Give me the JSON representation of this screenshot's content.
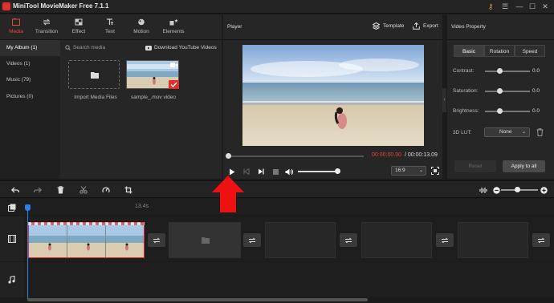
{
  "window": {
    "title": "MiniTool MovieMaker Free 7.1.1"
  },
  "toolbar": {
    "tabs": [
      {
        "label": "Media",
        "icon": "media-icon"
      },
      {
        "label": "Transition",
        "icon": "transition-icon"
      },
      {
        "label": "Effect",
        "icon": "effect-icon"
      },
      {
        "label": "Text",
        "icon": "text-icon"
      },
      {
        "label": "Motion",
        "icon": "motion-icon"
      },
      {
        "label": "Elements",
        "icon": "elements-icon"
      }
    ]
  },
  "sidebar": {
    "items": [
      {
        "label": "My Album (1)"
      },
      {
        "label": "Videos (1)"
      },
      {
        "label": "Music (79)"
      },
      {
        "label": "Pictures (0)"
      }
    ]
  },
  "media": {
    "search_placeholder": "Search media",
    "youtube_label": "Download YouTube Videos",
    "import_label": "Import Media Files",
    "video_label": "sample_.mov video"
  },
  "player": {
    "title": "Player",
    "template_label": "Template",
    "export_label": "Export",
    "current_time": "00:00:00.00",
    "total_time": "/ 00:00:13.09",
    "aspect_ratio": "16:9"
  },
  "property": {
    "title": "Video Property",
    "tabs": [
      {
        "label": "Basic"
      },
      {
        "label": "Rotation"
      },
      {
        "label": "Speed"
      }
    ],
    "sliders": [
      {
        "label": "Contrast:",
        "value": "0.0"
      },
      {
        "label": "Saturation:",
        "value": "0.0"
      },
      {
        "label": "Brightness:",
        "value": "0.0"
      }
    ],
    "lut_label": "3D LUT:",
    "lut_value": "None",
    "reset_label": "Reset",
    "apply_label": "Apply to all"
  },
  "timeline": {
    "ruler_time": "13.4s"
  },
  "colors": {
    "accent": "#e0302c",
    "playhead": "#2a82e4"
  }
}
